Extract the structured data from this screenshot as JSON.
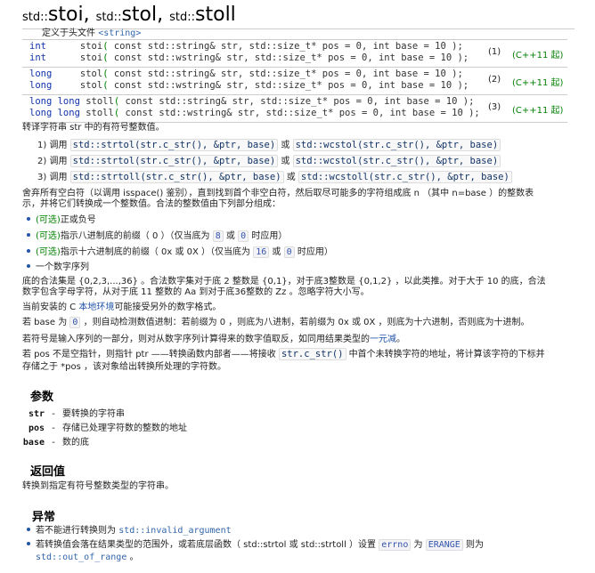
{
  "title": {
    "ns1": "std::",
    "f1": "stoi",
    "sep1": ", ",
    "ns2": "std::",
    "f2": "stol",
    "sep2": ", ",
    "ns3": "std::",
    "f3": "stoll"
  },
  "declarations": {
    "header_label": "定义于头文件 ",
    "header_name": "<string>",
    "groups": [
      {
        "lines": [
          {
            "ret": "int      ",
            "name": "stoi",
            "sig": " const std::string& str, std::size_t* pos = 0, int base = 10 );"
          },
          {
            "ret": "int      ",
            "name": "stoi",
            "sig": " const std::wstring& str, std::size_t* pos = 0, int base = 10 );"
          }
        ],
        "num": "(1)",
        "std": "(C++11 起)"
      },
      {
        "lines": [
          {
            "ret": "long     ",
            "name": "stol",
            "sig": " const std::string& str, std::size_t* pos = 0, int base = 10 );"
          },
          {
            "ret": "long     ",
            "name": "stol",
            "sig": " const std::wstring& str, std::size_t* pos = 0, int base = 10 );"
          }
        ],
        "num": "(2)",
        "std": "(C++11 起)"
      },
      {
        "lines": [
          {
            "ret": "long long ",
            "name": "stoll",
            "sig": " const std::string& str, std::size_t* pos = 0, int base = 10 );"
          },
          {
            "ret": "long long ",
            "name": "stoll",
            "sig": " const std::wstring& str, std::size_t* pos = 0, int base = 10 );"
          }
        ],
        "num": "(3)",
        "std": "(C++11 起)"
      }
    ]
  },
  "description": {
    "intro": "转译字符串 str 中的有符号整数值。",
    "calls": [
      {
        "prefix": "1) 调用 ",
        "a": "std::strtol(str.c_str(), &ptr, base)",
        "or": " 或 ",
        "b": "std::wcstol(str.c_str(), &ptr, base)"
      },
      {
        "prefix": "2) 调用 ",
        "a": "std::strtol(str.c_str(), &ptr, base)",
        "or": " 或 ",
        "b": "std::wcstol(str.c_str(), &ptr, base)"
      },
      {
        "prefix": "3) 调用 ",
        "a": "std::strtoll(str.c_str(), &ptr, base)",
        "or": " 或 ",
        "b": "std::wcstoll(str.c_str(), &ptr, base)"
      }
    ],
    "discard_line1": "舍弃所有空白符（以调用 isspace() 鉴别），直到找到首个非空白符，然后取尽可能多的字符组成底 n （其中 n=base ）的整数表",
    "discard_line2": "示，并将它们转换成一个整数值。合法的整数值由下列部分组成：",
    "parts": [
      {
        "opt": "(可选)",
        "text": "正或负号"
      },
      {
        "opt": "(可选)",
        "text": "指示八进制底的前缀（ 0 ）（仅当底为 ",
        "v1": "8",
        "mid": " 或 ",
        "v2": "0",
        "end": " 时应用）"
      },
      {
        "opt": "(可选)",
        "text": "指示十六进制底的前缀（ 0x 或 0X ）（仅当底为 ",
        "v1": "16",
        "mid": " 或 ",
        "v2": "0",
        "end": " 时应用）"
      },
      {
        "opt": "",
        "text": "一个数字序列"
      }
    ],
    "bases_line1": "底的合法集是 {0,2,3,...,36} 。合法数字集对于底 2 整数是 {0,1}，对于底3整数是 {0,1,2} ，以此类推。对于大于 10 的底，合法",
    "bases_line2": "数字包含字母字符，从对于底 11 整数的 Aa 到对于底36整数的 Zz 。忽略字符大小写。",
    "locale_pre": "当前安装的 C ",
    "locale_link": "本地环境",
    "locale_post": "可能接受另外的数字格式。",
    "base0_pre": "若 base 为 ",
    "base0_val": "0",
    "base0_post": " ，则自动检测数值进制：若前缀为 0 ，则底为八进制，若前缀为 0x 或 0X ，则底为十六进制，否则底为十进制。",
    "sign_pre": "若符号是输入序列的一部分，则对从数字序列计算得来的数字值取反，如同用结果类型的",
    "sign_link": "一元减",
    "sign_post": "。",
    "pos_pre": "若 pos 不是空指针，则指针 ptr ——转换函数内部者——将接收 ",
    "pos_code": "str.c_str()",
    "pos_post": " 中首个未转换字符的地址，将计算该字符的下标并",
    "pos_line2": "存储之于 *pos ，该对象给出转换所处理的字符数。"
  },
  "parameters": {
    "heading": "参数",
    "items": [
      {
        "name": "str",
        "dash": "-",
        "desc": "要转换的字符串"
      },
      {
        "name": "pos",
        "dash": "-",
        "desc": "存储已处理字符数的整数的地址"
      },
      {
        "name": "base",
        "dash": "-",
        "desc": "数的底"
      }
    ]
  },
  "return_value": {
    "heading": "返回值",
    "text": "转换到指定有符号整数类型的字符串。"
  },
  "exceptions": {
    "heading": "异常",
    "item1_pre": "若不能进行转换则为 ",
    "item1_code": "std::invalid_argument",
    "item2_pre": "若转换值会落在结果类型的范围外，或若底层函数（ std::strtol 或 std::strtoll ）设置 ",
    "item2_code1": "errno",
    "item2_mid": " 为 ",
    "item2_code2": "ERANGE",
    "item2_post": " 则为",
    "item2_code3": "std::out_of_range",
    "item2_end": " 。"
  }
}
